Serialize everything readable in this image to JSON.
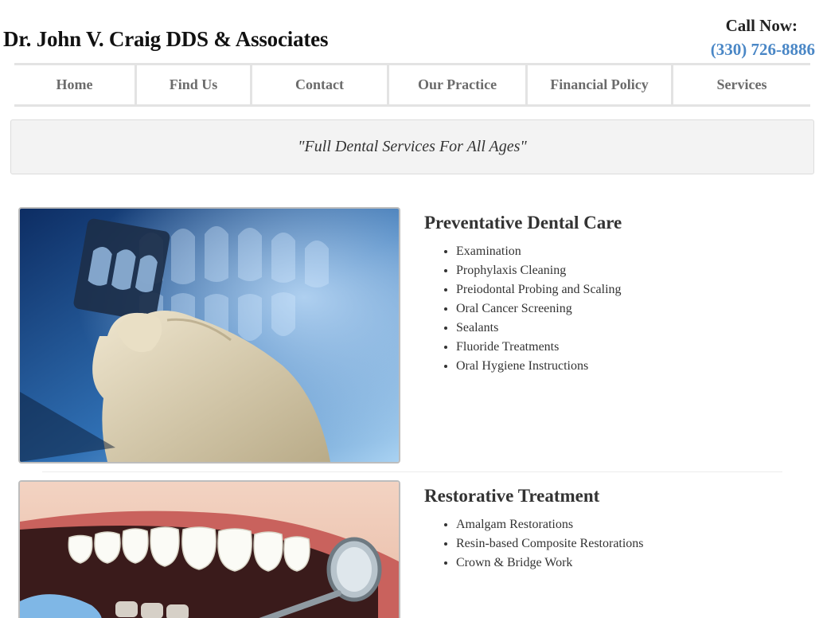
{
  "header": {
    "site_title": "Dr. John V. Craig DDS & Associates",
    "call_label": "Call Now:",
    "phone": "(330) 726-8886"
  },
  "nav": {
    "items": [
      {
        "label": "Home"
      },
      {
        "label": "Find Us"
      },
      {
        "label": "Contact"
      },
      {
        "label": "Our Practice"
      },
      {
        "label": "Financial Policy"
      },
      {
        "label": "Services"
      }
    ]
  },
  "tagline": "\"Full Dental Services For All Ages\"",
  "sections": [
    {
      "title": "Preventative Dental Care",
      "image": "dental-xray-photo",
      "items": [
        "Examination",
        "Prophylaxis Cleaning",
        "Preiodontal Probing and Scaling",
        "Oral Cancer Screening",
        "Sealants",
        "Fluoride Treatments",
        "Oral Hygiene Instructions"
      ]
    },
    {
      "title": "Restorative Treatment",
      "image": "teeth-mirror-photo",
      "items": [
        "Amalgam Restorations",
        "Resin-based Composite Restorations",
        "Crown & Bridge Work"
      ]
    }
  ],
  "colors": {
    "accent": "#4a87c6",
    "nav_text": "#6b6b6b",
    "tagline_bg": "#f3f3f3"
  }
}
